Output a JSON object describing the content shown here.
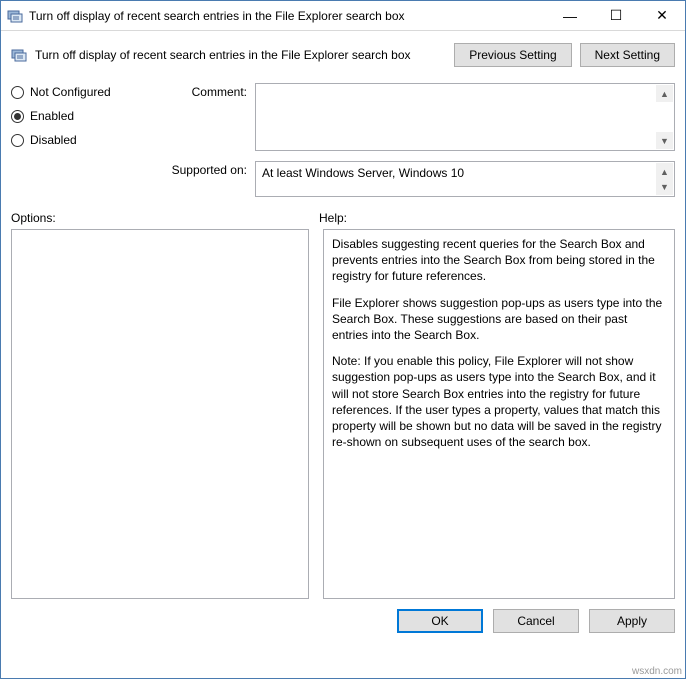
{
  "window": {
    "title": "Turn off display of recent search entries in the File Explorer search box",
    "controls": {
      "minimize": "—",
      "maximize": "☐",
      "close": "✕"
    }
  },
  "heading": "Turn off display of recent search entries in the File Explorer search box",
  "nav": {
    "previous": "Previous Setting",
    "next": "Next Setting"
  },
  "state": {
    "not_configured": "Not Configured",
    "enabled": "Enabled",
    "disabled": "Disabled",
    "selected": "enabled"
  },
  "fields": {
    "comment_label": "Comment:",
    "comment_value": "",
    "supported_label": "Supported on:",
    "supported_value": "At least Windows Server, Windows 10"
  },
  "sections": {
    "options": "Options:",
    "help": "Help:"
  },
  "help": {
    "p1": "Disables suggesting recent queries for the Search Box and prevents entries into the Search Box from being stored in the registry for future references.",
    "p2": "File Explorer shows suggestion pop-ups as users type into the Search Box.  These suggestions are based on their past entries into the Search Box.",
    "p3": "Note: If you enable this policy, File Explorer will not show suggestion pop-ups as users type into the Search Box, and it will not store Search Box entries into the registry for future references.  If the user types a property, values that match this property will be shown but no data will be saved in the registry re-shown on subsequent uses of the search box."
  },
  "buttons": {
    "ok": "OK",
    "cancel": "Cancel",
    "apply": "Apply"
  },
  "watermark": "wsxdn.com"
}
